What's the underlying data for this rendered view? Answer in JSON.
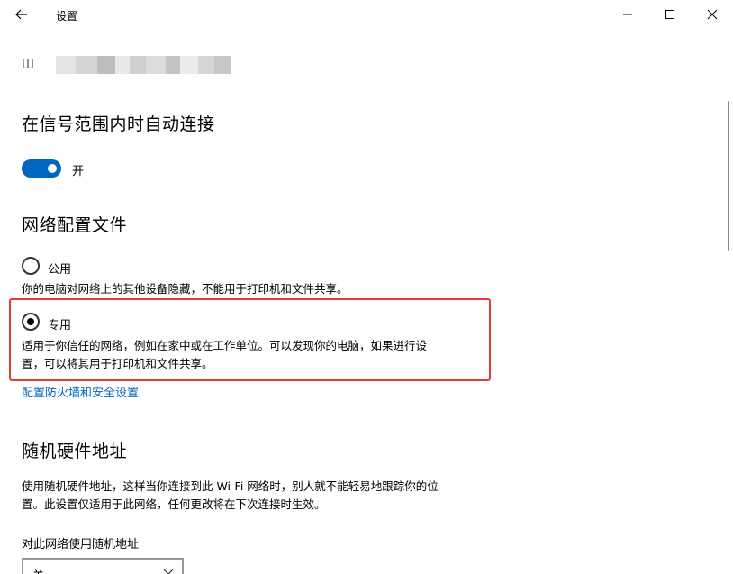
{
  "window": {
    "title": "设置",
    "back_icon": "back-arrow-icon",
    "minimize_icon": "minimize-icon",
    "maximize_icon": "maximize-icon",
    "close_icon": "close-icon"
  },
  "network": {
    "name_prefix": "Ш",
    "name_blurred": true
  },
  "auto_connect": {
    "heading": "在信号范围内时自动连接",
    "toggle_on": true,
    "toggle_label": "开"
  },
  "profile": {
    "heading": "网络配置文件",
    "options": [
      {
        "label": "公用",
        "selected": false,
        "description": "你的电脑对网络上的其他设备隐藏，不能用于打印机和文件共享。"
      },
      {
        "label": "专用",
        "selected": true,
        "description": "适用于你信任的网络，例如在家中或在工作单位。可以发现你的电脑，如果进行设置，可以将其用于打印机和文件共享。"
      }
    ],
    "firewall_link": "配置防火墙和安全设置"
  },
  "random_mac": {
    "heading": "随机硬件地址",
    "description": "使用随机硬件地址，这样当你连接到此 Wi-Fi 网络时，别人就不能轻易地跟踪你的位置。此设置仅适用于此网络，任何更改将在下次连接时生效。",
    "field_label": "对此网络使用随机地址",
    "dropdown_value": "关"
  },
  "colors": {
    "accent": "#0067c0",
    "highlight_border": "#e53935"
  }
}
